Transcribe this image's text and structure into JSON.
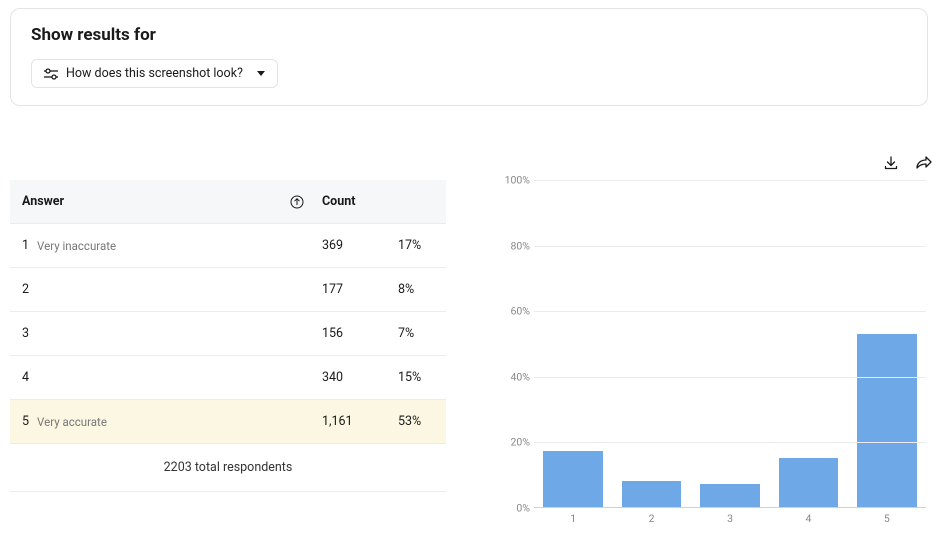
{
  "filter": {
    "heading": "Show results for",
    "chip_label": "How does this screenshot look?"
  },
  "table": {
    "header_answer": "Answer",
    "header_count": "Count",
    "rows": [
      {
        "rank": "1",
        "label": "Very inaccurate",
        "count": "369",
        "pct": "17%",
        "highlight": false
      },
      {
        "rank": "2",
        "label": "",
        "count": "177",
        "pct": "8%",
        "highlight": false
      },
      {
        "rank": "3",
        "label": "",
        "count": "156",
        "pct": "7%",
        "highlight": false
      },
      {
        "rank": "4",
        "label": "",
        "count": "340",
        "pct": "15%",
        "highlight": false
      },
      {
        "rank": "5",
        "label": "Very accurate",
        "count": "1,161",
        "pct": "53%",
        "highlight": true
      }
    ],
    "footer": "2203 total respondents"
  },
  "chart_data": {
    "type": "bar",
    "categories": [
      "1",
      "2",
      "3",
      "4",
      "5"
    ],
    "values": [
      17,
      8,
      7,
      15,
      53
    ],
    "title": "",
    "xlabel": "",
    "ylabel": "",
    "ylim": [
      0,
      100
    ],
    "y_ticks": [
      "0%",
      "20%",
      "40%",
      "60%",
      "80%",
      "100%"
    ]
  }
}
